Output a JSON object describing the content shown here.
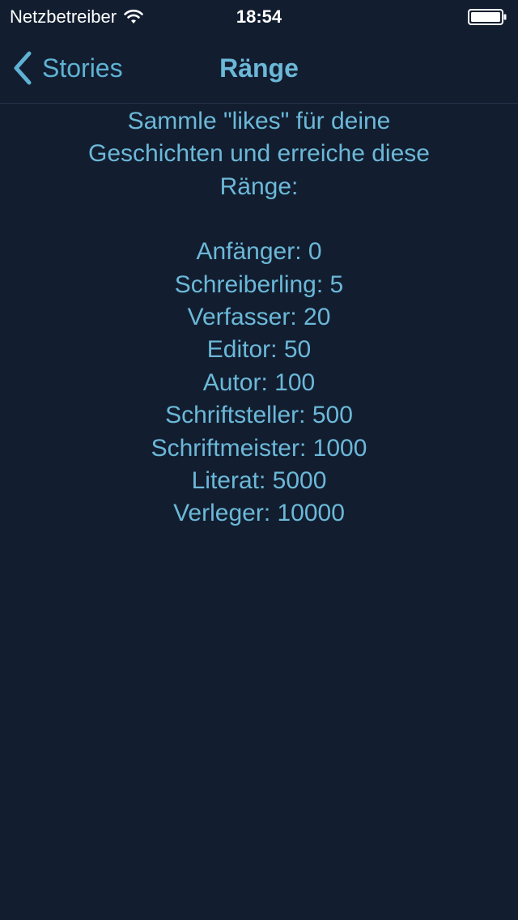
{
  "status_bar": {
    "carrier": "Netzbetreiber",
    "time": "18:54",
    "wifi_icon": "wifi-icon",
    "battery_icon": "battery-icon"
  },
  "nav": {
    "back_label": "Stories",
    "back_icon": "chevron-left-icon",
    "title": "Ränge"
  },
  "content": {
    "intro_line1": "Sammle \"likes\" für deine",
    "intro_line2": "Geschichten und erreiche diese",
    "intro_line3": "Ränge:",
    "ranks": [
      "Anfänger: 0",
      "Schreiberling: 5",
      "Verfasser: 20",
      "Editor: 50",
      "Autor: 100",
      "Schriftsteller: 500",
      "Schriftmeister: 1000",
      "Literat: 5000",
      "Verleger: 10000"
    ]
  },
  "colors": {
    "background": "#121e30",
    "accent": "#5fb2d4",
    "text": "#6cb8d8",
    "status_text": "#ffffff"
  }
}
